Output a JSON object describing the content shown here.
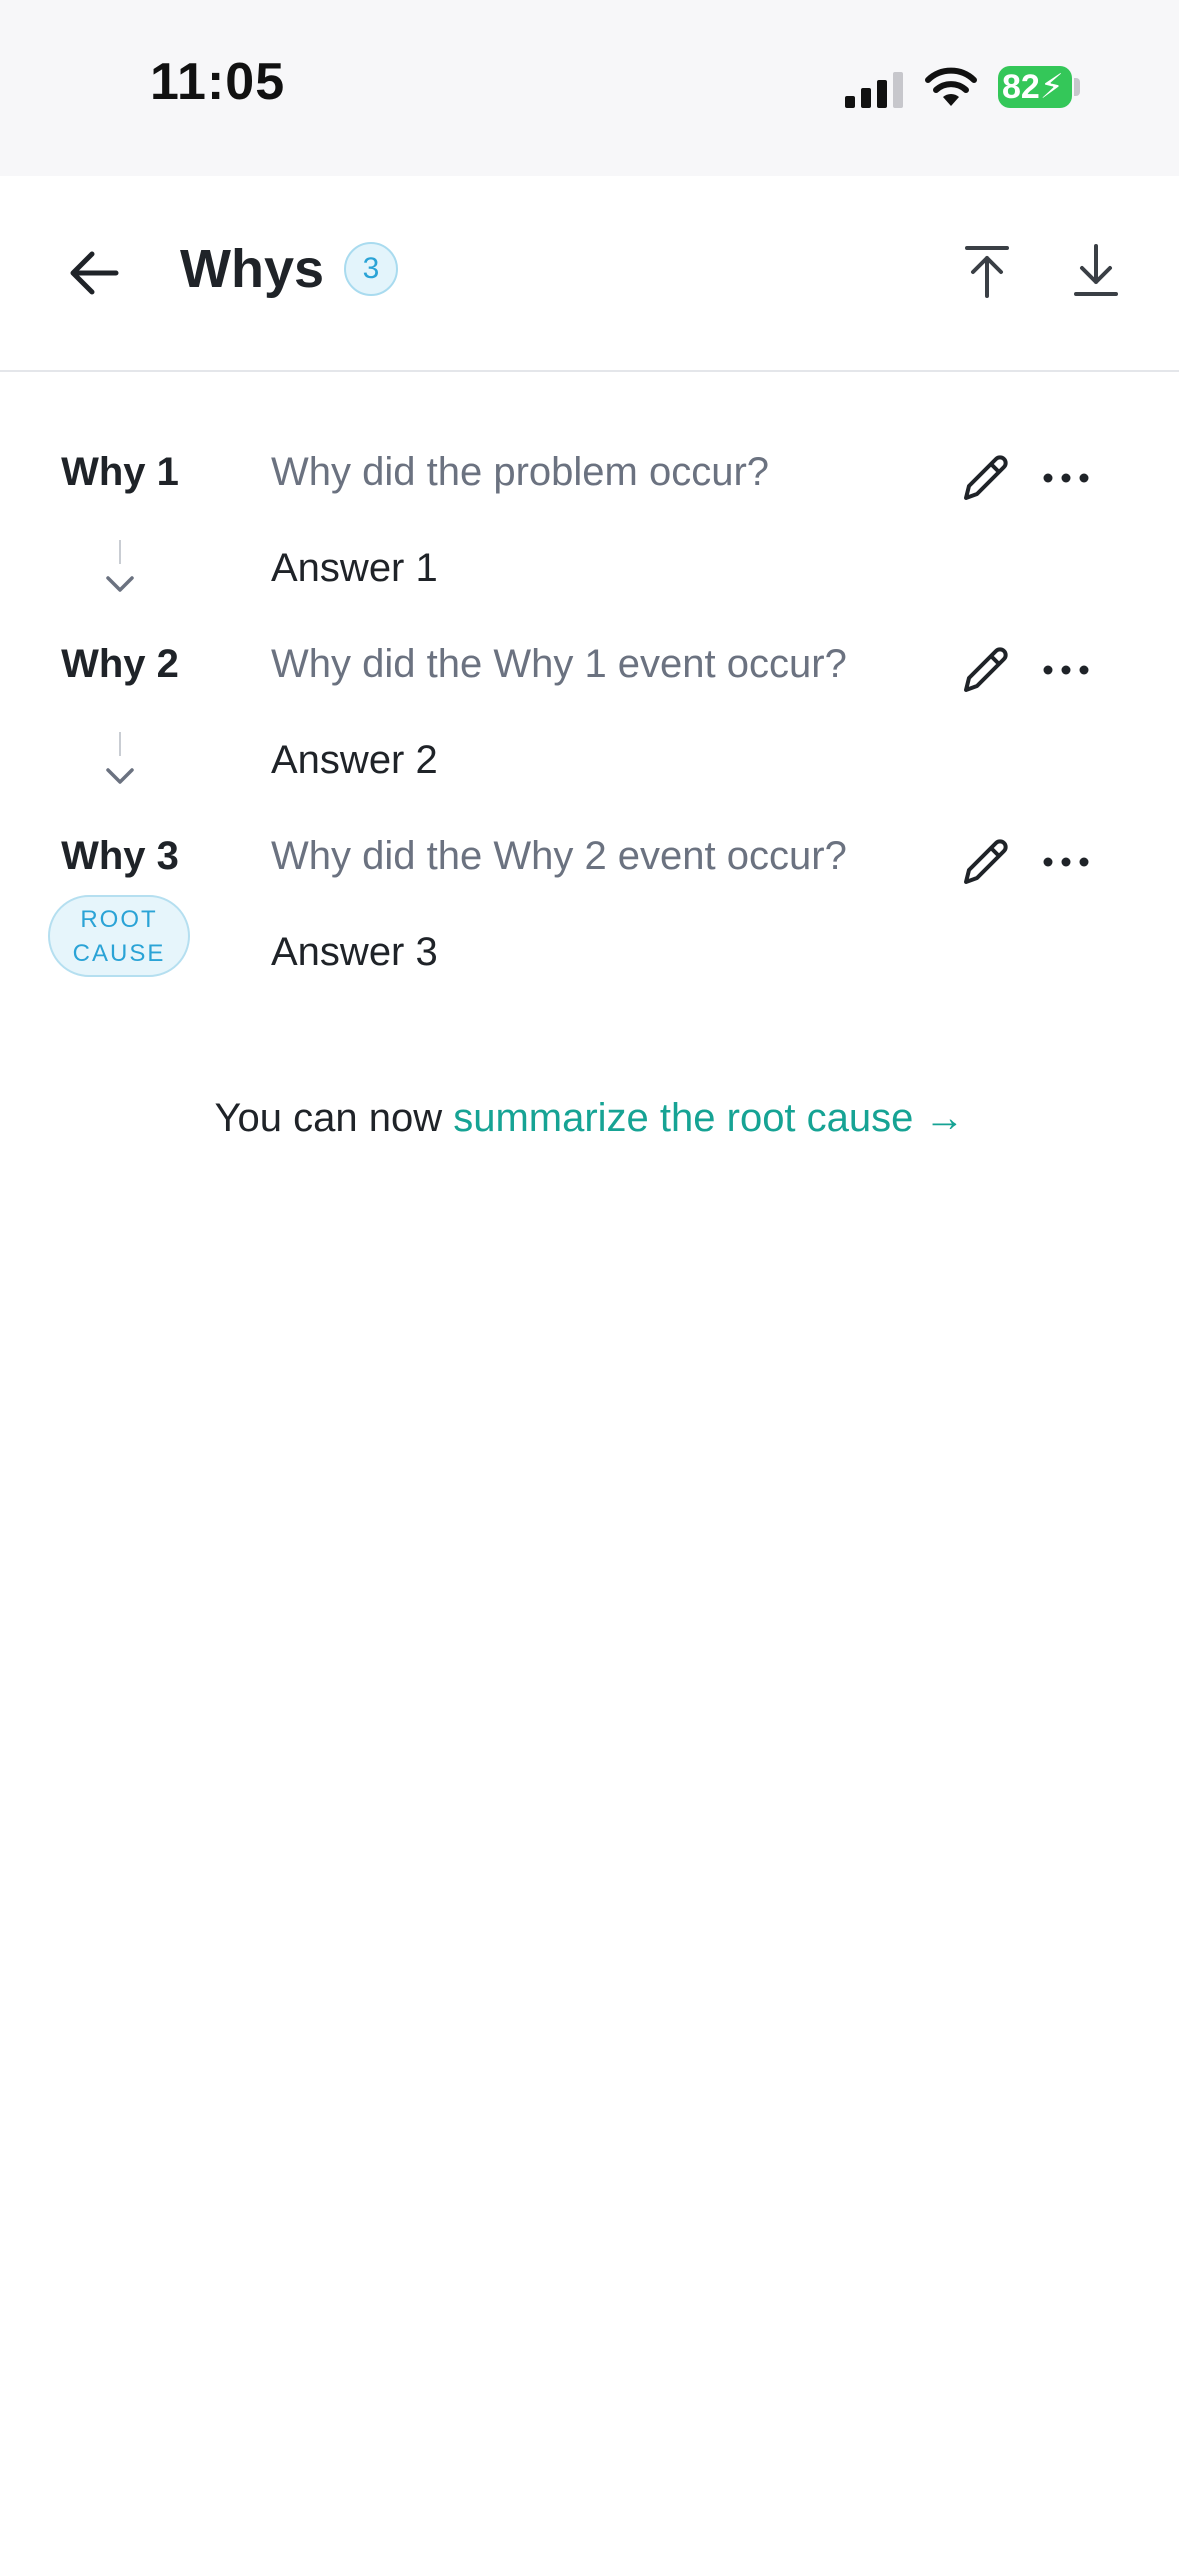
{
  "status_bar": {
    "time": "11:05",
    "battery": "82",
    "battery_color": "#34c759"
  },
  "header": {
    "title": "Whys",
    "count": "3",
    "back_icon": "arrow-left-icon",
    "upload_icon": "upload-top-icon",
    "download_icon": "download-icon"
  },
  "whys": [
    {
      "label": "Why 1",
      "question": "Why did the problem occur?",
      "answer": "Answer 1"
    },
    {
      "label": "Why 2",
      "question": "Why did the Why 1 event occur?",
      "answer": "Answer 2"
    },
    {
      "label": "Why 3",
      "question": "Why did the Why 2 event occur?",
      "answer": "Answer 3"
    }
  ],
  "root_cause_badge": {
    "line1": "ROOT",
    "line2": "CAUSE"
  },
  "summary": {
    "prefix": "You can now ",
    "link": "summarize the root cause →",
    "link_color": "#16a394"
  }
}
